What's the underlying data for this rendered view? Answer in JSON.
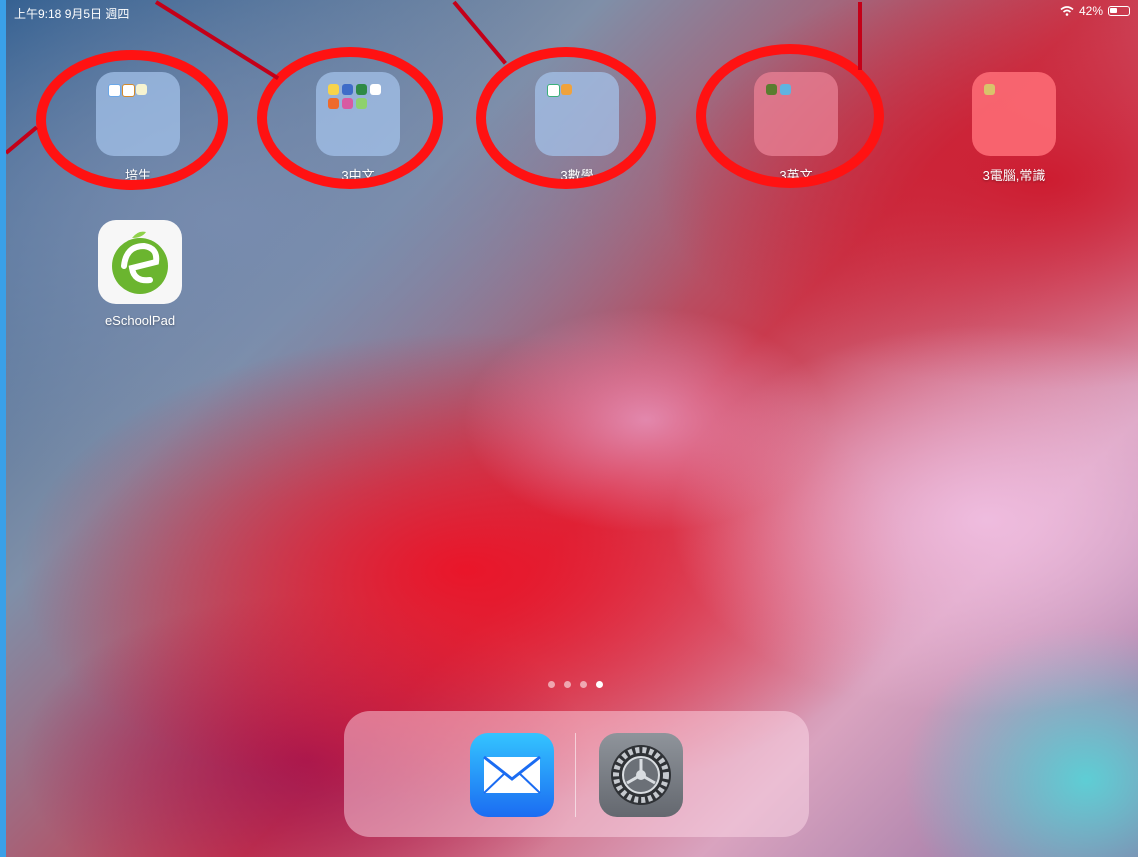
{
  "statusbar": {
    "time_date": "上午9:18  9月5日 週四",
    "battery_percent": "42%",
    "battery_level": 0.42
  },
  "folders": [
    {
      "label": "培生",
      "color": "blue"
    },
    {
      "label": "3中文",
      "color": "blue"
    },
    {
      "label": "3數學",
      "color": "blue"
    },
    {
      "label": "3英文",
      "color": "pink"
    },
    {
      "label": "3電腦,常識",
      "color": "red"
    }
  ],
  "apps": [
    {
      "label": "eSchoolPad",
      "logo_text": "eSCHOOLPAD"
    }
  ],
  "page_indicator": {
    "count": 4,
    "active": 4
  },
  "dock": [
    {
      "name": "mail",
      "icon": "envelope"
    },
    {
      "name": "settings",
      "icon": "gear"
    }
  ],
  "annotations": {
    "ring_color": "#ff1212",
    "line_color": "#c40018"
  }
}
